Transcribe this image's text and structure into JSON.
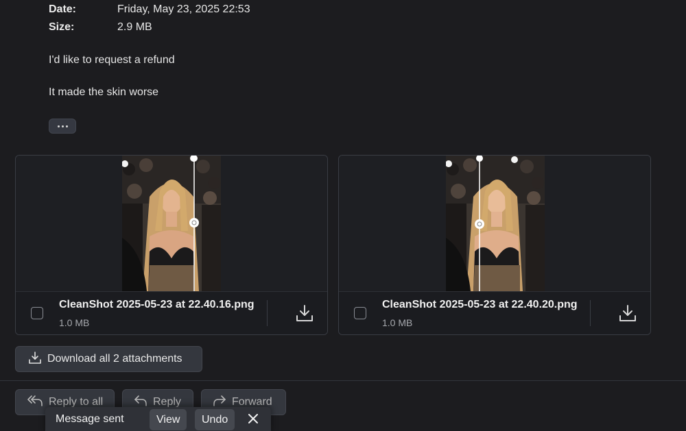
{
  "meta": {
    "date_label": "Date:",
    "date_value": "Friday, May 23, 2025 22:53",
    "size_label": "Size:",
    "size_value": "2.9 MB"
  },
  "body": {
    "line1": "I'd like to request a refund",
    "line2": "It made the skin worse"
  },
  "attachments": [
    {
      "name": "CleanShot 2025-05-23 at 22.40.16.png",
      "size": "1.0 MB",
      "checked": false
    },
    {
      "name": "CleanShot 2025-05-23 at 22.40.20.png",
      "size": "1.0 MB",
      "checked": false
    }
  ],
  "download_all_label": "Download all 2 attachments",
  "actions": {
    "reply_all": "Reply to all",
    "reply": "Reply",
    "forward": "Forward"
  },
  "toast": {
    "message": "Message sent",
    "view": "View",
    "undo": "Undo"
  },
  "icons": {
    "more": "ellipsis-icon",
    "download": "download-icon",
    "reply_all": "reply-all-icon",
    "reply": "reply-icon",
    "forward": "forward-icon",
    "close": "close-icon"
  },
  "colors": {
    "background": "#1c1c1f",
    "button_bg": "#34373e",
    "text": "#e6e6e6"
  }
}
